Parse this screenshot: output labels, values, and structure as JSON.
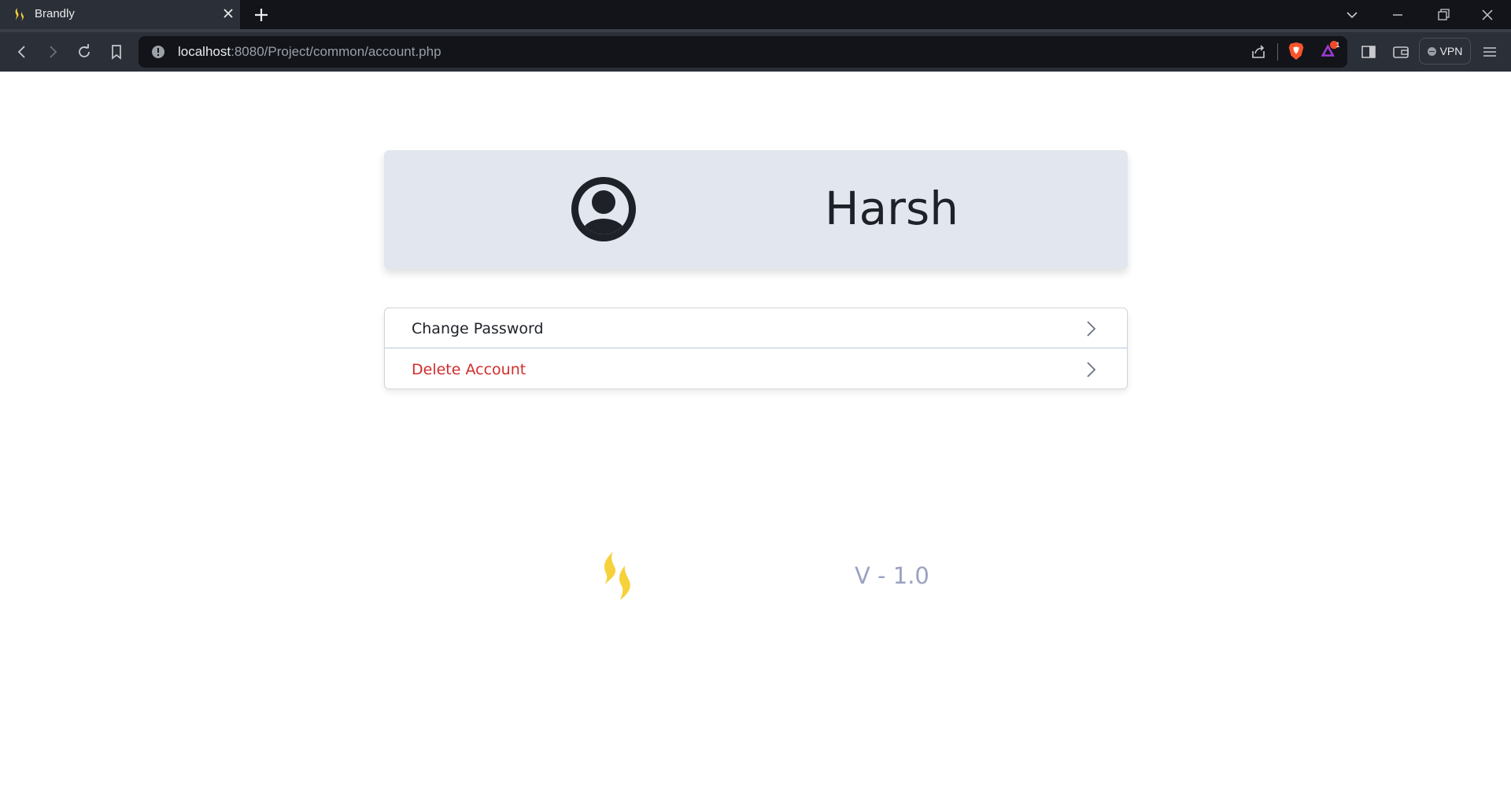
{
  "browser": {
    "tab": {
      "title": "Brandly",
      "favicon": "flame-logo-icon"
    },
    "url": {
      "host": "localhost",
      "rest": ":8080/Project/common/account.php"
    },
    "vpn_label": "VPN",
    "rewards_badge": "1"
  },
  "profile": {
    "name": "Harsh",
    "avatar_icon": "user-circle-icon"
  },
  "menu": {
    "items": [
      {
        "label": "Change Password",
        "style": "normal"
      },
      {
        "label": "Delete Account",
        "style": "danger",
        "color": "#d12c2c"
      }
    ]
  },
  "footer": {
    "logo": "flame-logo-icon",
    "version": "V - 1.0"
  },
  "colors": {
    "card_bg": "#e2e7ef",
    "logo_yellow": "#f7d13a",
    "version_text": "#9ba2c2"
  }
}
